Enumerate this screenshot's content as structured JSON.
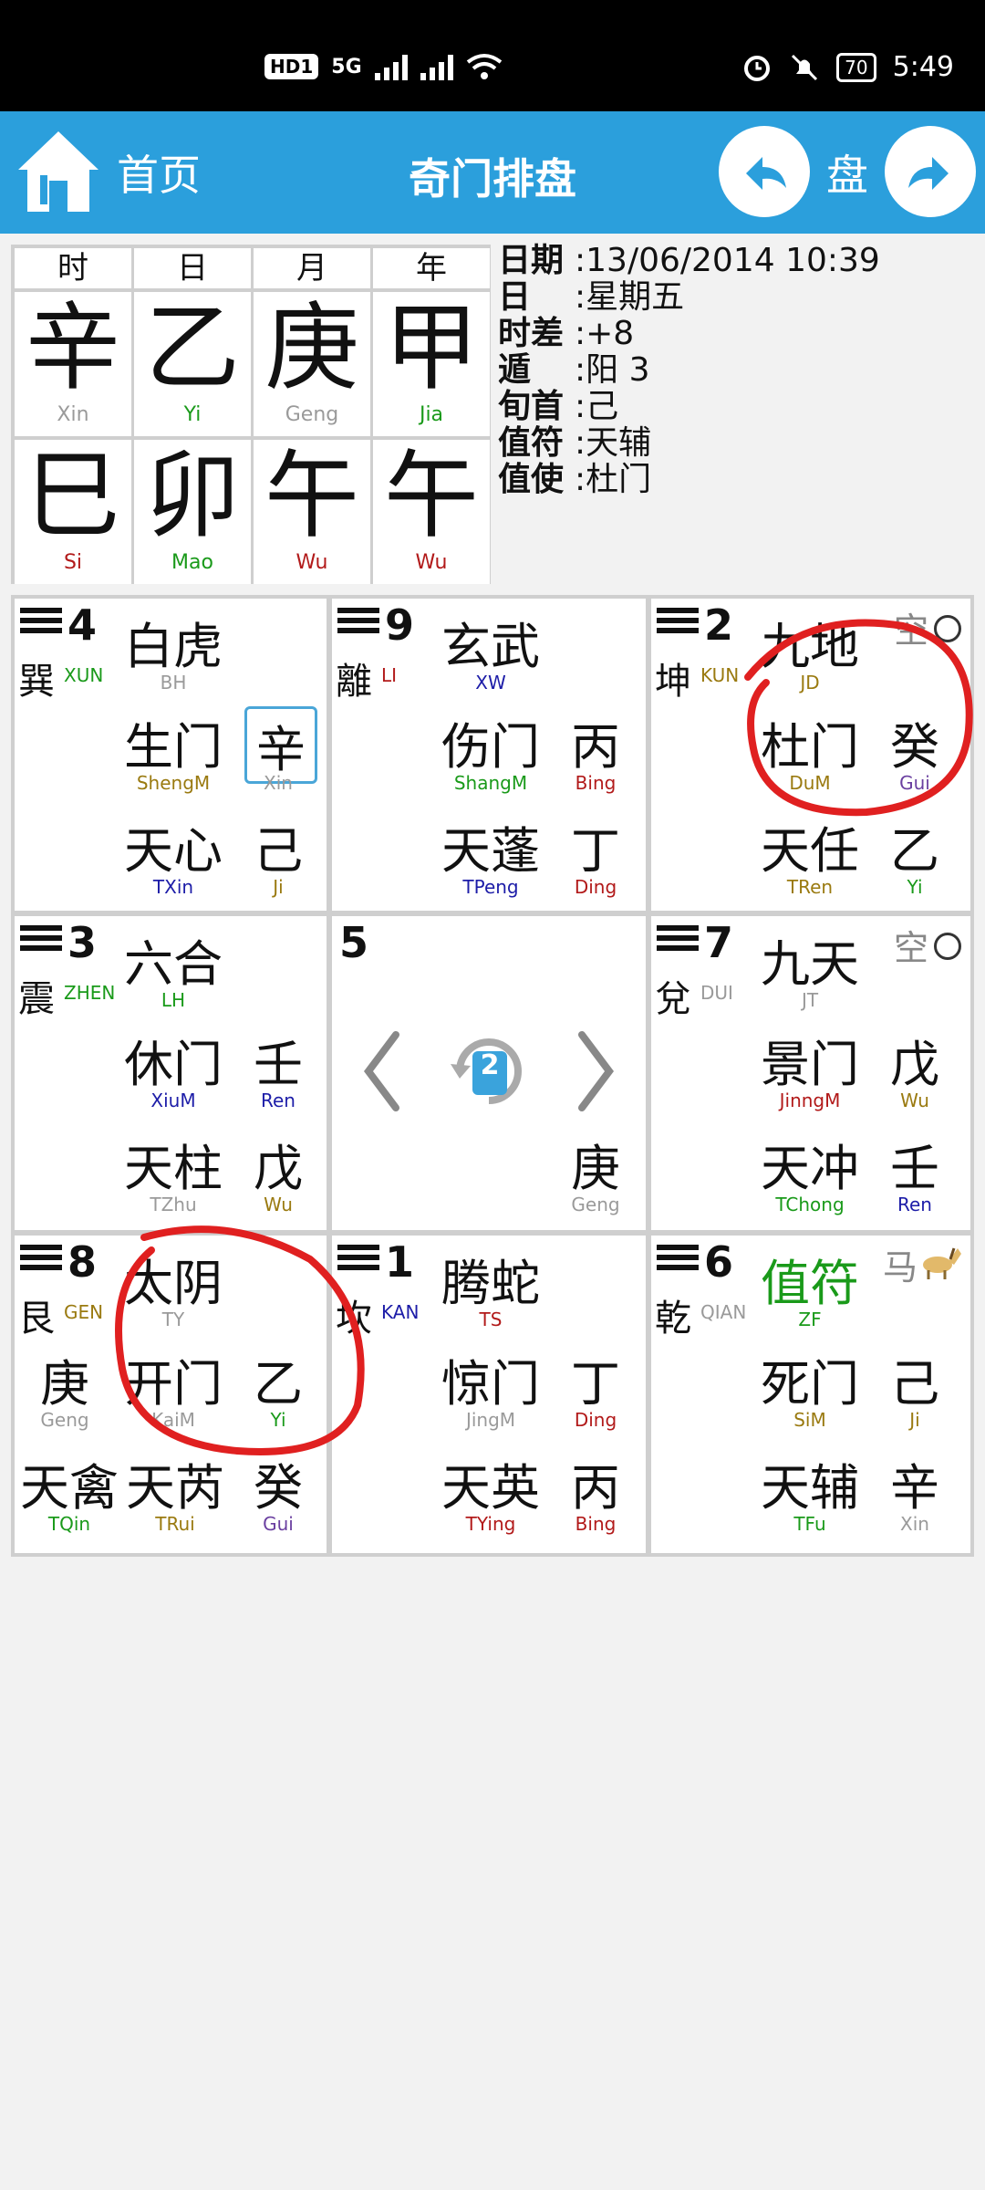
{
  "status_bar": {
    "hd": "HD",
    "sim": "1",
    "net": "5G",
    "battery": "70",
    "time": "5:49"
  },
  "header": {
    "home_label": "首页",
    "title": "奇门排盘",
    "pan_label": "盘"
  },
  "pillars": [
    {
      "header": "时",
      "stem": "辛",
      "stem_py": "Xin",
      "stem_color": "gray",
      "branch": "巳",
      "branch_py": "Si",
      "branch_color": "red"
    },
    {
      "header": "日",
      "stem": "乙",
      "stem_py": "Yi",
      "stem_color": "green",
      "branch": "卯",
      "branch_py": "Mao",
      "branch_color": "green"
    },
    {
      "header": "月",
      "stem": "庚",
      "stem_py": "Geng",
      "stem_color": "gray",
      "branch": "午",
      "branch_py": "Wu",
      "branch_color": "red"
    },
    {
      "header": "年",
      "stem": "甲",
      "stem_py": "Jia",
      "stem_color": "green",
      "branch": "午",
      "branch_py": "Wu",
      "branch_color": "red"
    }
  ],
  "info": [
    {
      "k": "日期",
      "v": ":13/06/2014 10:39"
    },
    {
      "k": "日",
      "v": ":星期五"
    },
    {
      "k": "时差",
      "v": ":+8"
    },
    {
      "k": "遁",
      "v": ":阳 3"
    },
    {
      "k": "旬首",
      "v": ":己"
    },
    {
      "k": "值符",
      "v": ":天辅"
    },
    {
      "k": "值使",
      "v": ":杜门"
    }
  ],
  "palaces": {
    "xun": {
      "num": "4",
      "name": "巽",
      "name_py": "XUN",
      "god": "白虎",
      "god_py": "BH",
      "door": "生门",
      "door_py": "ShengM",
      "door_stem": "辛",
      "door_stem_py": "Xin",
      "star": "天心",
      "star_py": "TXin",
      "star_stem": "己",
      "star_stem_py": "Ji"
    },
    "li": {
      "num": "9",
      "name": "離",
      "name_py": "LI",
      "god": "玄武",
      "god_py": "XW",
      "door": "伤门",
      "door_py": "ShangM",
      "door_stem": "丙",
      "door_stem_py": "Bing",
      "star": "天蓬",
      "star_py": "TPeng",
      "star_stem": "丁",
      "star_stem_py": "Ding"
    },
    "kun": {
      "num": "2",
      "name": "坤",
      "name_py": "KUN",
      "kong": "空",
      "god": "九地",
      "god_py": "JD",
      "door": "杜门",
      "door_py": "DuM",
      "door_stem": "癸",
      "door_stem_py": "Gui",
      "star": "天任",
      "star_py": "TRen",
      "star_stem": "乙",
      "star_stem_py": "Yi"
    },
    "zhen": {
      "num": "3",
      "name": "震",
      "name_py": "ZHEN",
      "god": "六合",
      "god_py": "LH",
      "door": "休门",
      "door_py": "XiuM",
      "door_stem": "壬",
      "door_stem_py": "Ren",
      "star": "天柱",
      "star_py": "TZhu",
      "star_stem": "戊",
      "star_stem_py": "Wu"
    },
    "center": {
      "num": "5",
      "page": "2",
      "stem": "庚",
      "stem_py": "Geng"
    },
    "dui": {
      "num": "7",
      "name": "兌",
      "name_py": "DUI",
      "kong": "空",
      "god": "九天",
      "god_py": "JT",
      "door": "景门",
      "door_py": "JinngM",
      "door_stem": "戊",
      "door_stem_py": "Wu",
      "star": "天冲",
      "star_py": "TChong",
      "star_stem": "壬",
      "star_stem_py": "Ren"
    },
    "gen": {
      "num": "8",
      "name": "艮",
      "name_py": "GEN",
      "god": "太阴",
      "god_py": "TY",
      "left_stem": "庚",
      "left_stem_py": "Geng",
      "door": "开门",
      "door_py": "KaiM",
      "door_stem": "乙",
      "door_stem_py": "Yi",
      "star": "天禽",
      "star_py": "TQin",
      "star2": "天芮",
      "star2_py": "TRui",
      "star_stem": "癸",
      "star_stem_py": "Gui"
    },
    "kan": {
      "num": "1",
      "name": "坎",
      "name_py": "KAN",
      "god": "腾蛇",
      "god_py": "TS",
      "door": "惊门",
      "door_py": "JingM",
      "door_stem": "丁",
      "door_stem_py": "Ding",
      "star": "天英",
      "star_py": "TYing",
      "star_stem": "丙",
      "star_stem_py": "Bing"
    },
    "qian": {
      "num": "6",
      "name": "乾",
      "name_py": "QIAN",
      "ma": "马",
      "god": "值符",
      "god_py": "ZF",
      "door": "死门",
      "door_py": "SiM",
      "door_stem": "己",
      "door_stem_py": "Ji",
      "star": "天辅",
      "star_py": "TFu",
      "star_stem": "辛",
      "star_stem_py": "Xin"
    }
  },
  "colors": {
    "header": "#2b9fdc",
    "annotation": "#e02020"
  }
}
